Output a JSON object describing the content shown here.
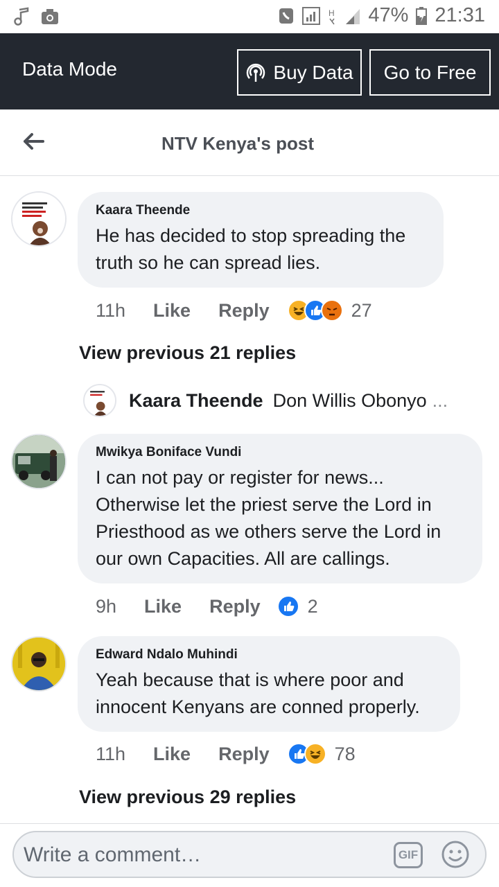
{
  "status_bar": {
    "battery": "47%",
    "time": "21:31"
  },
  "data_bar": {
    "label": "Data Mode",
    "buy_data": "Buy Data",
    "go_free": "Go to Free"
  },
  "header": {
    "title": "NTV Kenya's post"
  },
  "comments": [
    {
      "author": "Kaara Theende",
      "text": "He has decided to stop spreading the truth so he can spread lies.",
      "time": "11h",
      "like": "Like",
      "reply": "Reply",
      "reactions": [
        "haha-icon",
        "like-icon",
        "angry-icon"
      ],
      "count": "27",
      "avatar_text": "Tafuta pesa sasa ndio uakaaa kisasa"
    },
    {
      "author": "Mwikya Boniface Vundi",
      "text": "I can not pay or register for news... Otherwise let the priest serve the Lord in Priesthood as we others serve the Lord in our own Capacities. All are callings.",
      "time": "9h",
      "like": "Like",
      "reply": "Reply",
      "reactions": [
        "like-icon"
      ],
      "count": "2"
    },
    {
      "author": "Edward Ndalo Muhindi",
      "text": "Yeah because that is where poor and innocent Kenyans are conned properly.",
      "time": "11h",
      "like": "Like",
      "reply": "Reply",
      "reactions": [
        "like-icon",
        "haha-icon"
      ],
      "count": "78"
    }
  ],
  "view_previous_1": "View previous 21 replies",
  "reply_preview": {
    "author": "Kaara Theende",
    "text": "Don Willis Obonyo",
    "ellipsis": "..."
  },
  "view_previous_2": "View previous 29 replies",
  "composer": {
    "placeholder": "Write a comment…",
    "gif": "GIF"
  },
  "colors": {
    "data_bar": "#232830",
    "bubble": "#f0f2f5",
    "like_blue": "#1877f2",
    "haha_yellow": "#f7b125",
    "angry_orange": "#e9710f"
  }
}
